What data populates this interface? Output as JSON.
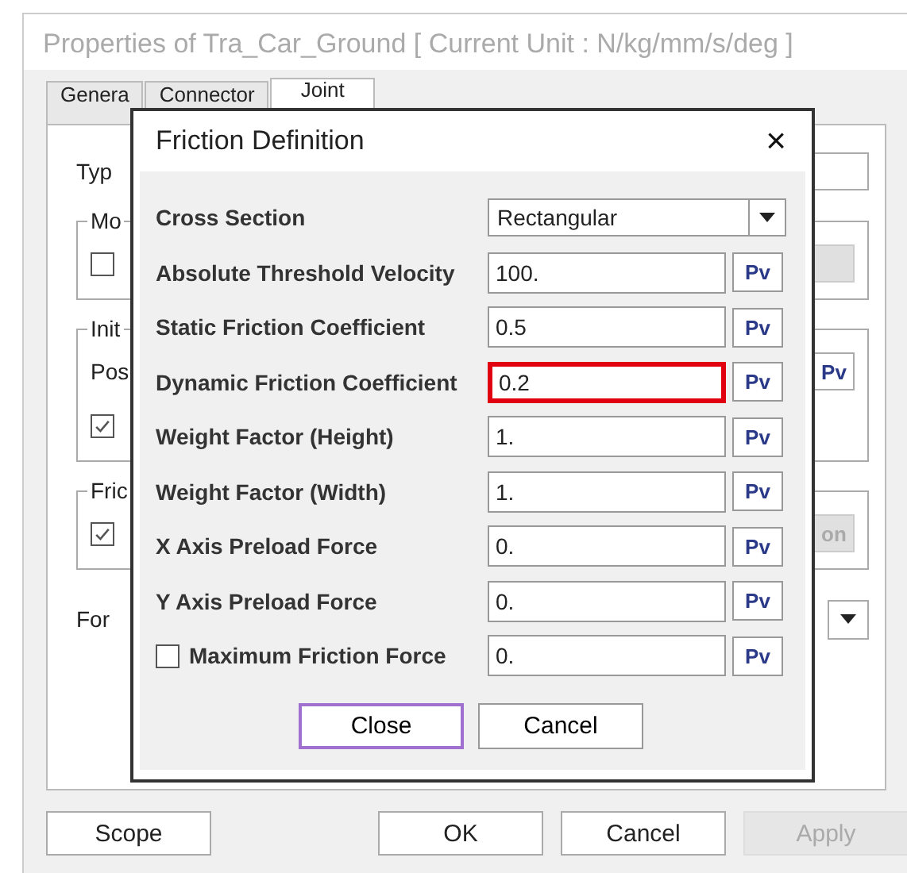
{
  "window": {
    "title": "Properties of Tra_Car_Ground [ Current Unit : N/kg/mm/s/deg ]"
  },
  "tabs": [
    {
      "label": "Genera",
      "selected": false
    },
    {
      "label": "Connector",
      "selected": false
    },
    {
      "label": "Joint",
      "selected": true
    }
  ],
  "panel": {
    "type_label": "Typ",
    "groups": [
      {
        "title": "Mo",
        "rows": [
          {
            "kind": "checkbox",
            "checked": false,
            "button": {
              "disabled": true
            }
          }
        ]
      },
      {
        "title": "Init",
        "rows": [
          {
            "kind": "label",
            "label": "Pos",
            "button": {
              "label": "Pv",
              "disabled": false
            }
          },
          {
            "kind": "checkbox",
            "checked": true
          }
        ]
      },
      {
        "title": "Fric",
        "rows": [
          {
            "kind": "checkbox",
            "checked": true,
            "button": {
              "label": "on",
              "disabled": true
            }
          }
        ]
      }
    ],
    "force_label": "For"
  },
  "buttons": [
    {
      "label": "Scope",
      "disabled": false
    },
    {
      "label": "OK",
      "disabled": false
    },
    {
      "label": "Cancel",
      "disabled": false
    },
    {
      "label": "Apply",
      "disabled": true
    }
  ],
  "dialog": {
    "title": "Friction Definition",
    "close": "×",
    "rows": [
      {
        "kind": "dropdown",
        "label": "Cross Section",
        "value": "Rectangular"
      },
      {
        "kind": "field",
        "label": "Absolute Threshold Velocity",
        "value": "100.",
        "pv": "Pv",
        "highlighted": false
      },
      {
        "kind": "field",
        "label": "Static Friction Coefficient",
        "value": "0.5",
        "pv": "Pv",
        "highlighted": false
      },
      {
        "kind": "field",
        "label": "Dynamic Friction Coefficient",
        "value": "0.2",
        "pv": "Pv",
        "highlighted": true
      },
      {
        "kind": "field",
        "label": "Weight Factor (Height)",
        "value": "1.",
        "pv": "Pv",
        "highlighted": false
      },
      {
        "kind": "field",
        "label": "Weight Factor (Width)",
        "value": "1.",
        "pv": "Pv",
        "highlighted": false
      },
      {
        "kind": "field",
        "label": "X Axis Preload Force",
        "value": "0.",
        "pv": "Pv",
        "highlighted": false
      },
      {
        "kind": "field",
        "label": "Y Axis Preload Force",
        "value": "0.",
        "pv": "Pv",
        "highlighted": false
      },
      {
        "kind": "checkfield",
        "label": "Maximum Friction Force",
        "checked": false,
        "value": "0.",
        "pv": "Pv",
        "highlighted": false
      }
    ],
    "buttons": [
      {
        "label": "Close",
        "focused": true
      },
      {
        "label": "Cancel",
        "focused": false
      }
    ]
  }
}
